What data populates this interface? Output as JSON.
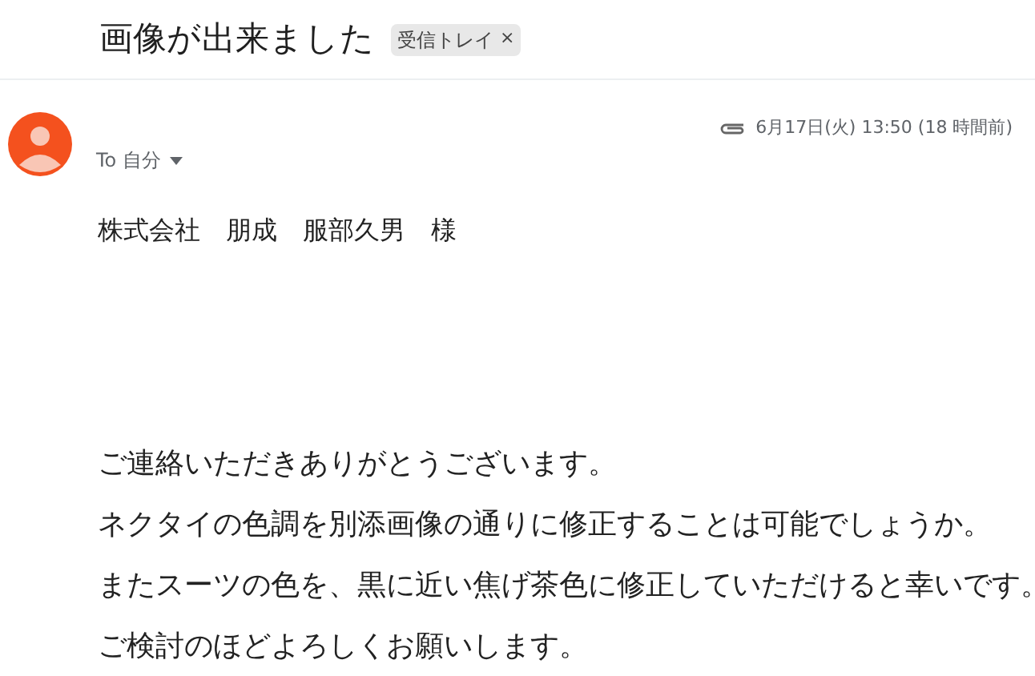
{
  "subject": "画像が出来ました",
  "label": {
    "text": "受信トレイ",
    "close": "×"
  },
  "message": {
    "has_attachment": true,
    "date": "6月17日(火) 13:50 (18 時間前)",
    "to": "To 自分",
    "salutation": "株式会社　朋成　服部久男　様",
    "body": [
      "ご連絡いただきありがとうございます。",
      "ネクタイの色調を別添画像の通りに修正することは可能でしょうか。",
      "またスーツの色を、黒に近い焦げ茶色に修正していただけると幸いです。",
      "ご検討のほどよろしくお願いします。"
    ]
  }
}
